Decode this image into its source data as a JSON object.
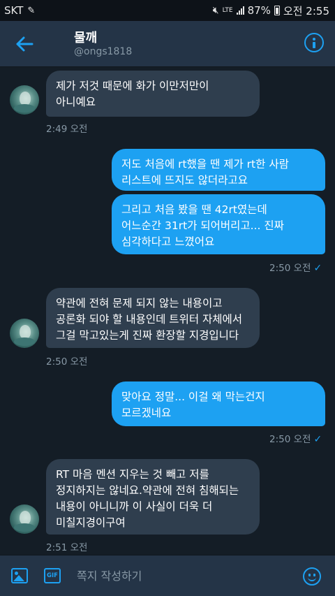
{
  "status": {
    "carrier": "SKT",
    "battery": "87%",
    "time": "오전 2:55",
    "lte": "LTE"
  },
  "header": {
    "name": "물깨",
    "handle": "@ongs1818"
  },
  "messages": {
    "m1": {
      "l1": "제가 저것 때문에 화가 이만저만이",
      "l2": "아니예요",
      "ts": "2:49 오전"
    },
    "m2": {
      "l1": "저도 처음에 rt했을 땐 제가 rt한 사람",
      "l2": "리스트에 뜨지도 않더라고요"
    },
    "m3": {
      "l1": "그리고 처음 봤을 땐 42rt였는데",
      "l2": "어느순간 31rt가 되어버리고... 진짜",
      "l3": "심각하다고 느꼈어요",
      "ts": "2:50 오전"
    },
    "m4": {
      "l1": "약관에 전혀 문제 되지 않는 내용이고",
      "l2": "공론화 되야 할 내용인데 트위터 자체에서",
      "l3": "그걸 막고있는게 진짜 환장할 지경입니다",
      "ts": "2:50 오전"
    },
    "m5": {
      "l1": "맞아요 정말... 이걸 왜 막는건지",
      "l2": "모르겠네요",
      "ts": "2:50 오전"
    },
    "m6": {
      "l1": "RT 마음 멘션 지우는 것 빼고 저를",
      "l2": "정지하지는 않네요.약관에 전혀 침해되는",
      "l3": "내용이 아니니까 이 사실이 더욱 더",
      "l4": "미칠지경이구여",
      "ts": "2:51 오전"
    }
  },
  "composer": {
    "placeholder": "쪽지 작성하기",
    "gif_label": "GIF"
  },
  "colors": {
    "accent": "#1da1f2",
    "header_bg": "#243447",
    "page_bg": "#141d26",
    "incoming_bubble": "#2f3e4e"
  },
  "icons": [
    "back-arrow-icon",
    "info-icon",
    "image-icon",
    "gif-icon",
    "emoji-icon",
    "read-check-icon"
  ]
}
